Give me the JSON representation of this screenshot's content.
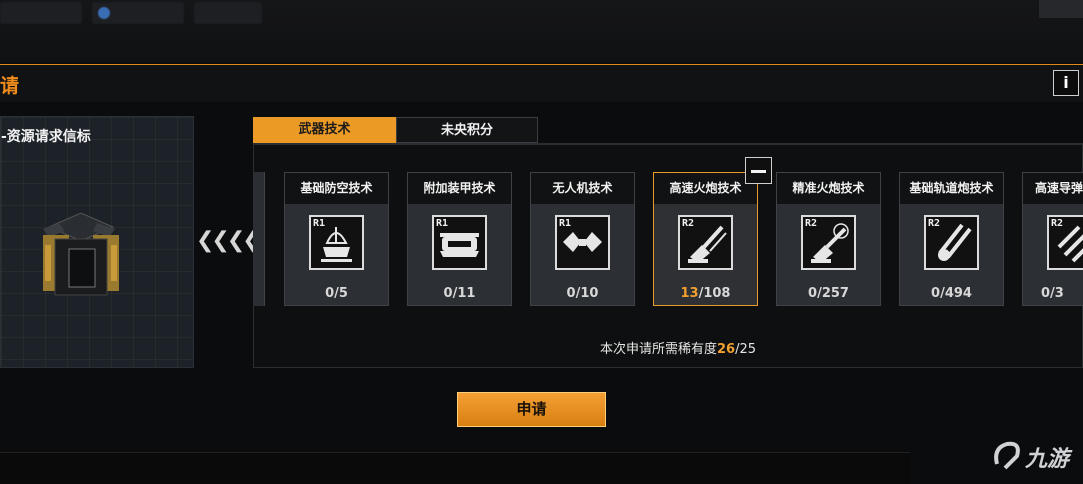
{
  "header": {
    "title": "请",
    "info_label": "i"
  },
  "item": {
    "name": "-资源请求信标"
  },
  "tabs": [
    {
      "label": "武器技术",
      "active": true
    },
    {
      "label": "未央积分",
      "active": false
    }
  ],
  "cards": [
    {
      "title": "基础防空技术",
      "rank": "R1",
      "icon": "radar-dish-icon",
      "current": "0",
      "total": "/5",
      "selected": false
    },
    {
      "title": "附加装甲技术",
      "rank": "R1",
      "icon": "armor-plate-icon",
      "current": "0",
      "total": "/11",
      "selected": false
    },
    {
      "title": "无人机技术",
      "rank": "R1",
      "icon": "drone-icon",
      "current": "0",
      "total": "/10",
      "selected": false
    },
    {
      "title": "高速火炮技术",
      "rank": "R2",
      "icon": "rapid-cannon-icon",
      "current": "13",
      "total": "/108",
      "selected": true
    },
    {
      "title": "精准火炮技术",
      "rank": "R2",
      "icon": "precision-cannon-icon",
      "current": "0",
      "total": "/257",
      "selected": false
    },
    {
      "title": "基础轨道炮技术",
      "rank": "R2",
      "icon": "railgun-icon",
      "current": "0",
      "total": "/494",
      "selected": false
    },
    {
      "title": "高速导弹",
      "rank": "R2",
      "icon": "missile-icon",
      "current": "0",
      "total": "/3",
      "selected": false
    }
  ],
  "rarity": {
    "label": "本次申请所需稀有度",
    "current": "26",
    "total": "/25"
  },
  "apply_button": "申请",
  "colors": {
    "accent": "#eb9a26",
    "highlight": "#f0a030"
  }
}
